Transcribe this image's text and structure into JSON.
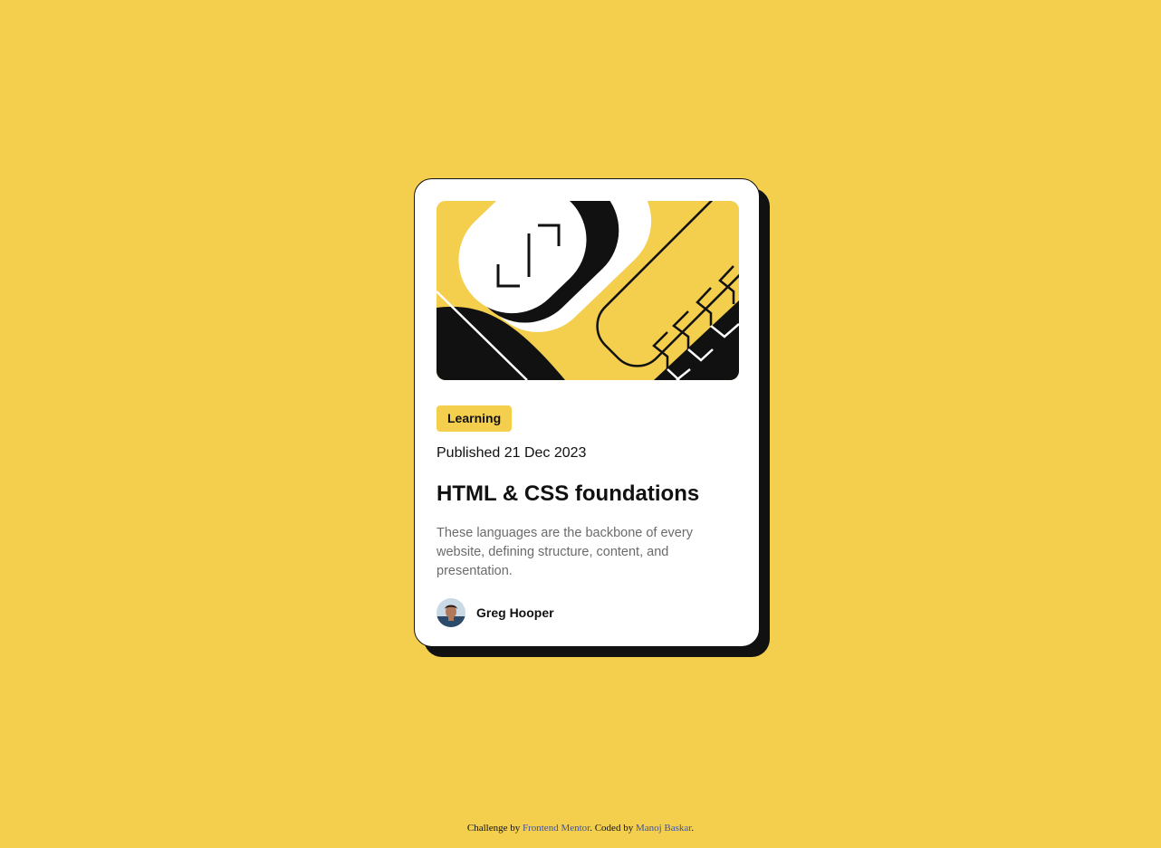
{
  "card": {
    "tag": "Learning",
    "published": "Published 21 Dec 2023",
    "title": "HTML & CSS foundations",
    "description": "These languages are the backbone of every website, defining structure, content, and presentation.",
    "author": "Greg Hooper",
    "hero_icon": "blog-illustration",
    "avatar_icon": "author-avatar"
  },
  "attribution": {
    "prefix": "Challenge by ",
    "link1": "Frontend Mentor",
    "middle": ". Coded by ",
    "link2": "Manoj Baskar",
    "suffix": "."
  },
  "colors": {
    "background": "#F4CF4E",
    "ink": "#111111",
    "card": "#FFFFFF",
    "muted": "#6B6B6B",
    "link": "#3E52A3"
  }
}
